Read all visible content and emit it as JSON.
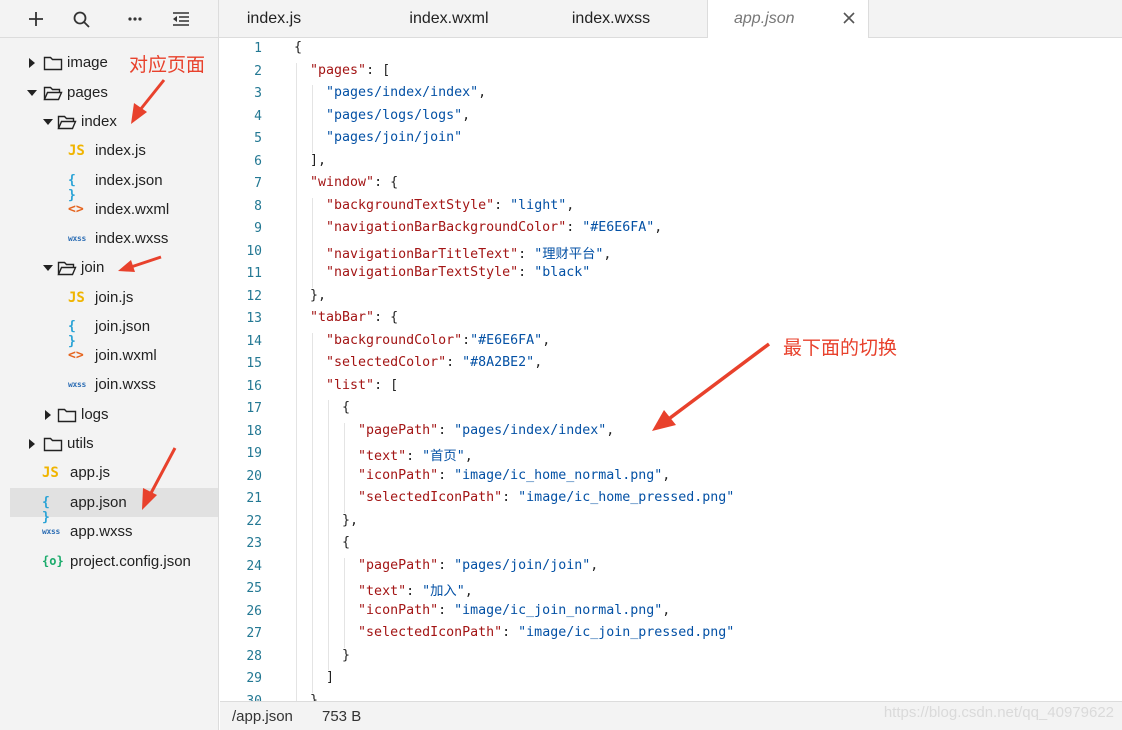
{
  "toolbar": {
    "icons": [
      "plus-icon",
      "search-icon",
      "more-icon",
      "collapse-icon"
    ]
  },
  "tree": [
    {
      "label": "image",
      "type": "folder",
      "open": false,
      "depth": 0
    },
    {
      "label": "pages",
      "type": "folder",
      "open": true,
      "depth": 0
    },
    {
      "label": "index",
      "type": "folder",
      "open": true,
      "depth": 1
    },
    {
      "label": "index.js",
      "type": "js",
      "icon": "JS",
      "depth": 2
    },
    {
      "label": "index.json",
      "type": "json",
      "icon": "{ }",
      "depth": 2
    },
    {
      "label": "index.wxml",
      "type": "wxml",
      "icon": "<>",
      "depth": 2
    },
    {
      "label": "index.wxss",
      "type": "wxss",
      "icon": "wxss",
      "depth": 2
    },
    {
      "label": "join",
      "type": "folder",
      "open": true,
      "depth": 1
    },
    {
      "label": "join.js",
      "type": "js",
      "icon": "JS",
      "depth": 2
    },
    {
      "label": "join.json",
      "type": "json",
      "icon": "{ }",
      "depth": 2
    },
    {
      "label": "join.wxml",
      "type": "wxml",
      "icon": "<>",
      "depth": 2
    },
    {
      "label": "join.wxss",
      "type": "wxss",
      "icon": "wxss",
      "depth": 2
    },
    {
      "label": "logs",
      "type": "folder",
      "open": false,
      "depth": 1
    },
    {
      "label": "utils",
      "type": "folder",
      "open": false,
      "depth": 0
    },
    {
      "label": "app.js",
      "type": "js",
      "icon": "JS",
      "depth": 0
    },
    {
      "label": "app.json",
      "type": "json",
      "icon": "{ }",
      "depth": 0,
      "selected": true
    },
    {
      "label": "app.wxss",
      "type": "wxss",
      "icon": "wxss",
      "depth": 0
    },
    {
      "label": "project.config.json",
      "type": "proj",
      "icon": "{o}",
      "depth": 0
    }
  ],
  "tabs": [
    {
      "label": "index.js",
      "active": false
    },
    {
      "label": "index.wxml",
      "active": false
    },
    {
      "label": "index.wxss",
      "active": false
    },
    {
      "label": "app.json",
      "active": true
    }
  ],
  "code_lines": [
    "{",
    "  \"pages\": [",
    "    \"pages/index/index\",",
    "    \"pages/logs/logs\",",
    "    \"pages/join/join\"",
    "  ],",
    "  \"window\": {",
    "    \"backgroundTextStyle\": \"light\",",
    "    \"navigationBarBackgroundColor\": \"#E6E6FA\",",
    "    \"navigationBarTitleText\": \"理财平台\",",
    "    \"navigationBarTextStyle\": \"black\"",
    "  },",
    "  \"tabBar\": {",
    "    \"backgroundColor\":\"#E6E6FA\",",
    "    \"selectedColor\": \"#8A2BE2\",",
    "    \"list\": [",
    "      {",
    "        \"pagePath\": \"pages/index/index\",",
    "        \"text\": \"首页\",",
    "        \"iconPath\": \"image/ic_home_normal.png\",",
    "        \"selectedIconPath\": \"image/ic_home_pressed.png\"",
    "      },",
    "      {",
    "        \"pagePath\": \"pages/join/join\",",
    "        \"text\": \"加入\",",
    "        \"iconPath\": \"image/ic_join_normal.png\",",
    "        \"selectedIconPath\": \"image/ic_join_pressed.png\"",
    "      }",
    "    ]",
    "  }",
    "}"
  ],
  "line_numbers_shown": 30,
  "status": {
    "path": "/app.json",
    "size": "753 B"
  },
  "annotations": {
    "pages_note": "对应页面",
    "tabbar_note": "最下面的切换"
  },
  "watermark": "https://blog.csdn.net/qq_40979622",
  "colors": {
    "annotation": "#e8412c",
    "key": "#a31515",
    "string": "#0451a5",
    "line_number": "#237893"
  }
}
